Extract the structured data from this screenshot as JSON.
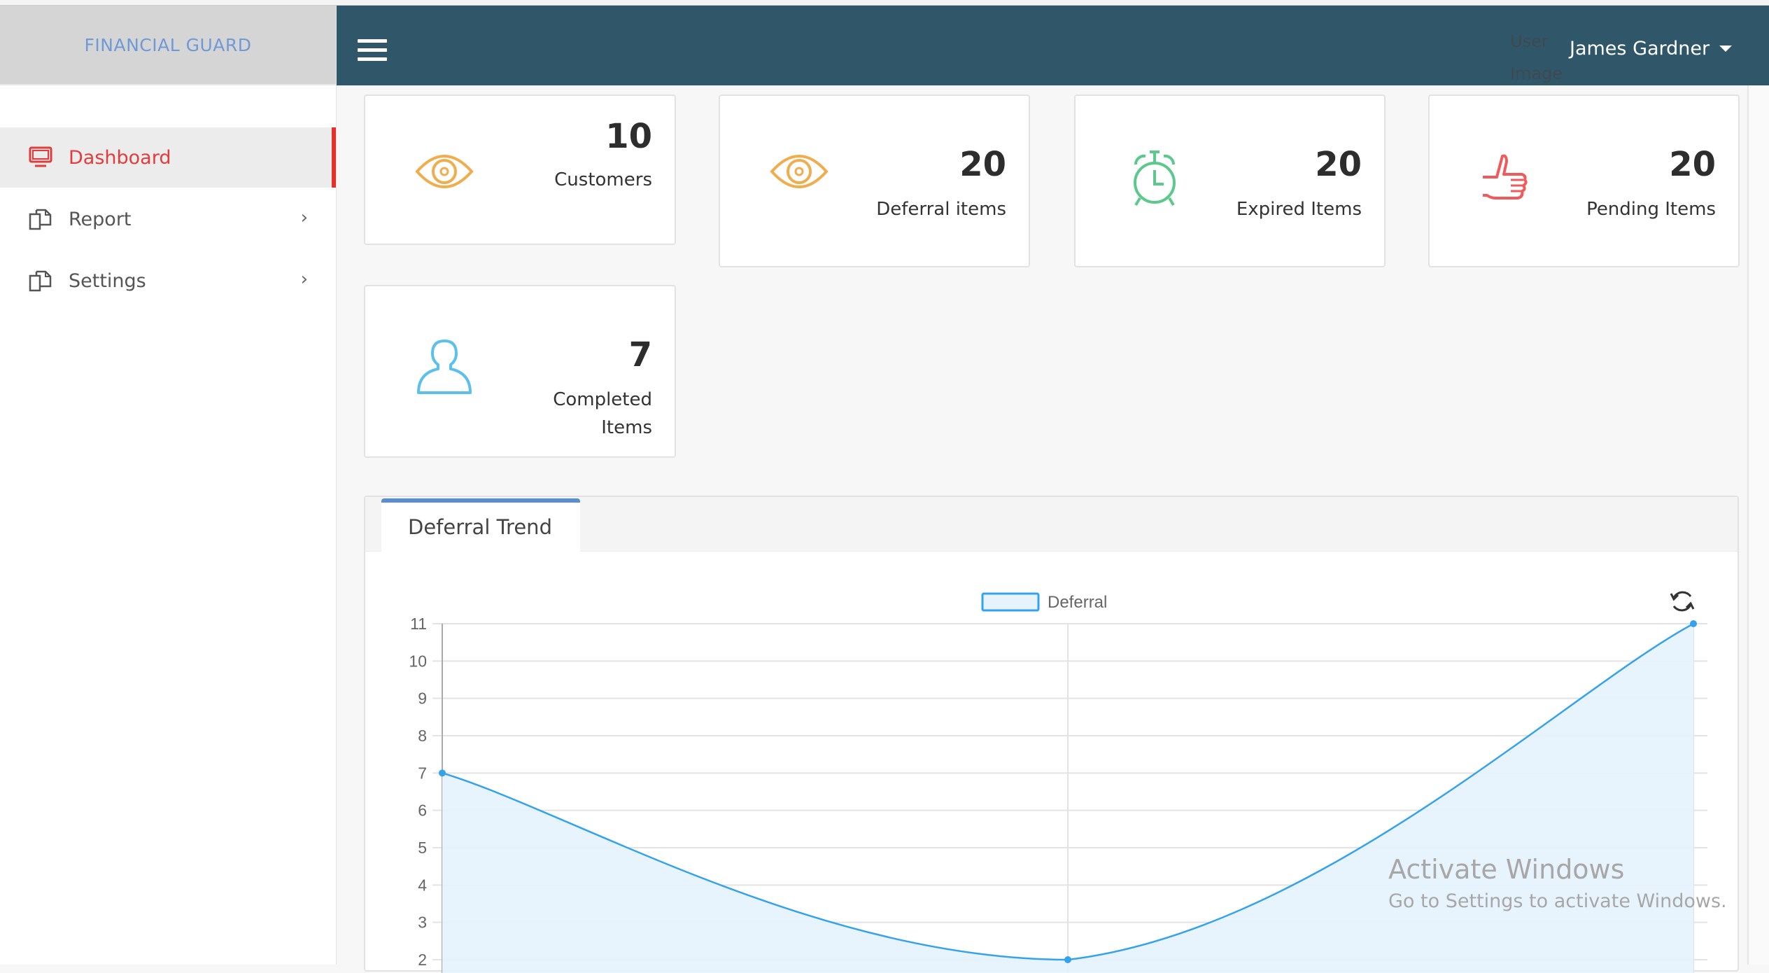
{
  "app": {
    "logo_text": "FINANCIAL GUARD"
  },
  "header": {
    "menu_icon": "hamburger-menu-icon",
    "user_image_alt": "User Image",
    "user_name": "James Gardner"
  },
  "sidebar": {
    "items": [
      {
        "label": "Dashboard",
        "icon": "monitor-icon",
        "active": true,
        "has_submenu": false
      },
      {
        "label": "Report",
        "icon": "documents-icon",
        "active": false,
        "has_submenu": true
      },
      {
        "label": "Settings",
        "icon": "documents-icon",
        "active": false,
        "has_submenu": true
      }
    ]
  },
  "cards": [
    {
      "value": "10",
      "label": "Customers",
      "icon": "eye-icon",
      "color": "#f0ad4e"
    },
    {
      "value": "20",
      "label": "Deferral items",
      "icon": "eye-icon",
      "color": "#f0ad4e"
    },
    {
      "value": "20",
      "label": "Expired Items",
      "icon": "alarm-clock-icon",
      "color": "#5bc98c"
    },
    {
      "value": "20",
      "label": "Pending Items",
      "icon": "thumbs-up-icon",
      "color": "#f05a5a"
    },
    {
      "value": "7",
      "label": "Completed Items",
      "icon": "user-icon",
      "color": "#5bc0eb"
    }
  ],
  "panel": {
    "tab_label": "Deferral Trend",
    "refresh_icon": "refresh-icon"
  },
  "chart_data": {
    "type": "area",
    "title": "",
    "legend": [
      "Deferral"
    ],
    "legend_position": "top",
    "x": [
      "",
      "",
      ""
    ],
    "series": [
      {
        "name": "Deferral",
        "values": [
          7,
          2,
          11
        ],
        "color": "#36a2eb",
        "fill": "#e6f3fd"
      }
    ],
    "yticks": [
      2,
      3,
      4,
      5,
      6,
      7,
      8,
      9,
      10,
      11
    ],
    "ylim": [
      2,
      11
    ],
    "xlabel": "",
    "ylabel": "",
    "grid": true
  },
  "watermark": {
    "line1": "Activate Windows",
    "line2": "Go to Settings to activate Windows."
  }
}
